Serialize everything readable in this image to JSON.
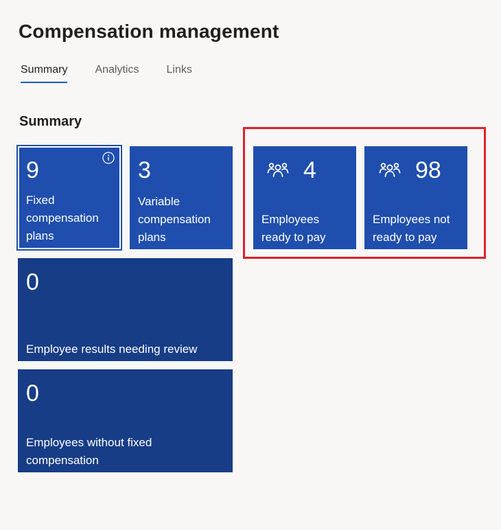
{
  "page": {
    "title": "Compensation management"
  },
  "tabs": [
    {
      "label": "Summary"
    },
    {
      "label": "Analytics"
    },
    {
      "label": "Links"
    }
  ],
  "summary": {
    "title": "Summary",
    "tiles": [
      {
        "count": "9",
        "label": "Fixed compensation plans"
      },
      {
        "count": "3",
        "label": "Variable compensation plans"
      },
      {
        "count": "4",
        "label": "Employees ready to pay"
      },
      {
        "count": "98",
        "label": "Employees not ready to pay"
      },
      {
        "count": "0",
        "label": "Employee results needing review"
      },
      {
        "count": "0",
        "label": "Employees without fixed compensation"
      }
    ]
  },
  "colors": {
    "tile": "#1f4eae",
    "tile_dark": "#173d86",
    "highlight": "#e0202a",
    "tab_underline": "#1a5cc4"
  },
  "icons": {
    "info": "info-icon",
    "people": "people-icon"
  }
}
